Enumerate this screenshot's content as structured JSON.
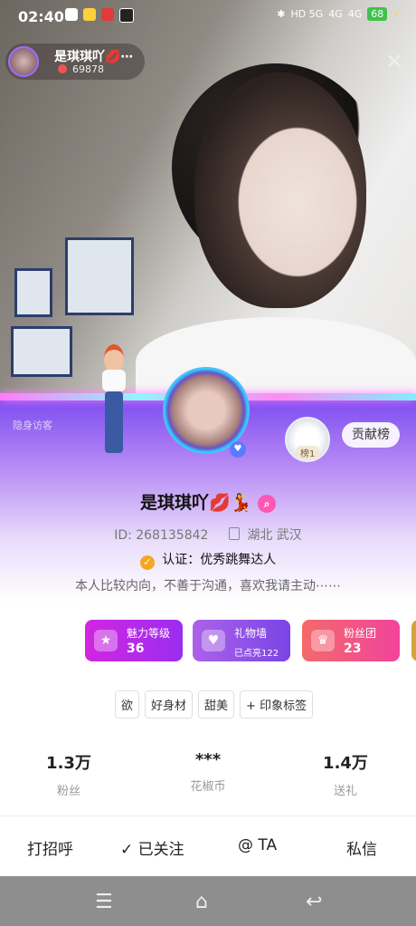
{
  "status_bar": {
    "time": "02:40",
    "network_1": "HD 5G",
    "network_2": "4G",
    "network_3": "4G",
    "battery": "68"
  },
  "anchor": {
    "name": "是琪琪吖💋⋯",
    "popularity": "69878"
  },
  "profile": {
    "hidden_label": "隐身访客",
    "contribution_rank_label": "榜1",
    "contribution_button": "贡献榜",
    "nickname": "是琪琪吖💋💃",
    "id_text": "ID: 268135842",
    "location": "湖北 武汉",
    "certification": "认证：优秀跳舞达人",
    "bio": "本人比较内向，不善于沟通，喜欢我请主动⋯⋯"
  },
  "feature_cards": [
    {
      "title": "魅力等级",
      "value": "36",
      "icon": "star-icon"
    },
    {
      "title": "礼物墙",
      "sub": "已点亮122",
      "icon": "heart-icon"
    },
    {
      "title": "粉丝团",
      "value": "23",
      "icon": "crown-icon"
    }
  ],
  "tags": [
    "欲",
    "好身材",
    "甜美",
    "+ 印象标签"
  ],
  "stats": [
    {
      "value": "1.3万",
      "label": "粉丝"
    },
    {
      "value": "***",
      "label": "花椒币"
    },
    {
      "value": "1.4万",
      "label": "送礼"
    }
  ],
  "actions": {
    "greet": "打招呼",
    "followed": "✓ 已关注",
    "mention": "@ TA",
    "message": "私信"
  },
  "colors": {
    "accent_purple": "#7a48f0",
    "charm_card": "#d126e0",
    "gift_card": "#8b52e8",
    "fan_card": "#f2439d"
  }
}
